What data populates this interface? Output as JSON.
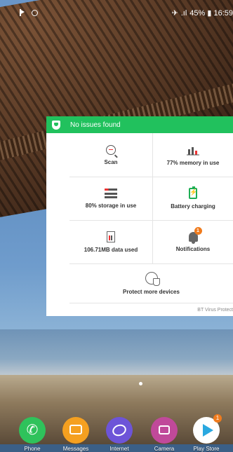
{
  "status_bar": {
    "right_text": "45% ▮ 16:59"
  },
  "widget": {
    "header": "No issues found",
    "cells": {
      "scan": "Scan",
      "memory": "77% memory in use",
      "storage": "80% storage in use",
      "battery": "Battery charging",
      "data": "106.71MB data used",
      "notifications": "Notifications",
      "protect": "Protect more devices"
    },
    "notifications_badge": "1",
    "footer": "BT Virus Protect"
  },
  "dock": {
    "apps": [
      {
        "label": "Phone",
        "icon": "phone-icon"
      },
      {
        "label": "Messages",
        "icon": "messages-icon"
      },
      {
        "label": "Internet",
        "icon": "internet-icon"
      },
      {
        "label": "Camera",
        "icon": "camera-icon"
      },
      {
        "label": "Play Store",
        "icon": "play-store-icon"
      }
    ],
    "play_store_badge": "1"
  },
  "colors": {
    "header_green": "#21c15d",
    "badge_orange": "#f07b1d"
  }
}
